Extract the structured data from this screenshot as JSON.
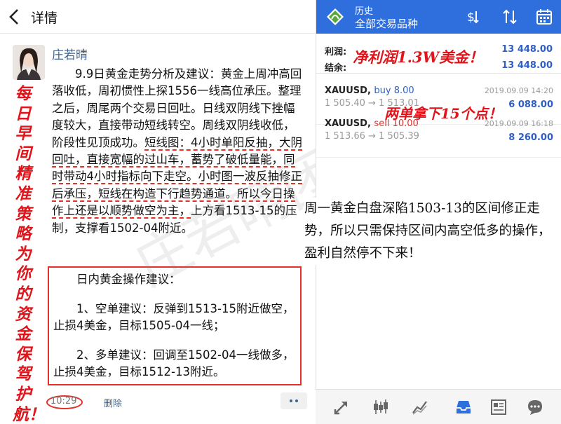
{
  "left": {
    "header": {
      "back_icon": "chevron-left-icon",
      "title": "详情"
    },
    "author": "庄若晴",
    "post_segments": [
      {
        "text": "9.9日黄金走势分析及建议：黄金上周冲高回落收低，周初惯性上探1556一线高位承压。整理之后，周尾两个交易日回吐。日线双阴线下挫幅度较大，直接带动短线转空。周线双阴线收低，阶段性见顶成功。",
        "underline": false
      },
      {
        "text": "短线图：4小时单阳反抽，大阴回吐，直接宽幅的过山车，蓄势了破低量能，同时带动4小时指标向下走空。小时图一波反抽修正后承压，短线在构造下行趋势通道。所以今日操作上还是以顺势做空为主，",
        "underline": true
      },
      {
        "text": "上方看1513-15的压制，支撑看1502-04附近。",
        "underline": false
      }
    ],
    "advice": {
      "title": "日内黄金操作建议：",
      "short": "1、空单建议：反弹到1513-15附近做空，止损4美金，目标1505-04一线；",
      "long": "2、多单建议：回调至1502-04一线做多，止损4美金，目标1512-13附近。"
    },
    "slogan": "每日早间精准策略为你的资金保驾护航！",
    "time": "10:29",
    "delete_label": "删除",
    "more_icon": "more-dots-icon",
    "watermark": "庄若晴团队"
  },
  "right": {
    "header": {
      "logo_icon": "metatrader-logo-icon",
      "title": "历史",
      "subtitle": "全部交易品种",
      "icons": [
        "dollar-sort-icon",
        "sort-arrows-icon",
        "calendar-icon"
      ]
    },
    "summary": [
      {
        "label": "利润:",
        "value": "13 448.00"
      },
      {
        "label": "结余:",
        "value": "13 448.00"
      }
    ],
    "callout_profit": "净利润1.3W美金！",
    "callout_points": "两单拿下15个点！",
    "orders": [
      {
        "symbol": "XAUUSD,",
        "side": "buy 8.00",
        "type": "buy",
        "date": "2019.09.09 14:20",
        "prices": "1 505.40 → 1 513.01",
        "profit": "6 088.00"
      },
      {
        "symbol": "XAUUSD,",
        "side": "sell 10.00",
        "type": "sell",
        "date": "2019.09.09 16:18",
        "prices": "1 513.66 → 1 505.39",
        "profit": "8 260.00"
      }
    ],
    "paragraph": "周一黄金白盘深陷1503-13的区间修正走势，所以只需保持区间内高空低多的操作，盈利自然停不下来！",
    "nav_icons": [
      "trade-icon",
      "candlestick-chart-icon",
      "line-chart-icon",
      "inbox-icon",
      "news-icon",
      "chat-icon"
    ]
  }
}
